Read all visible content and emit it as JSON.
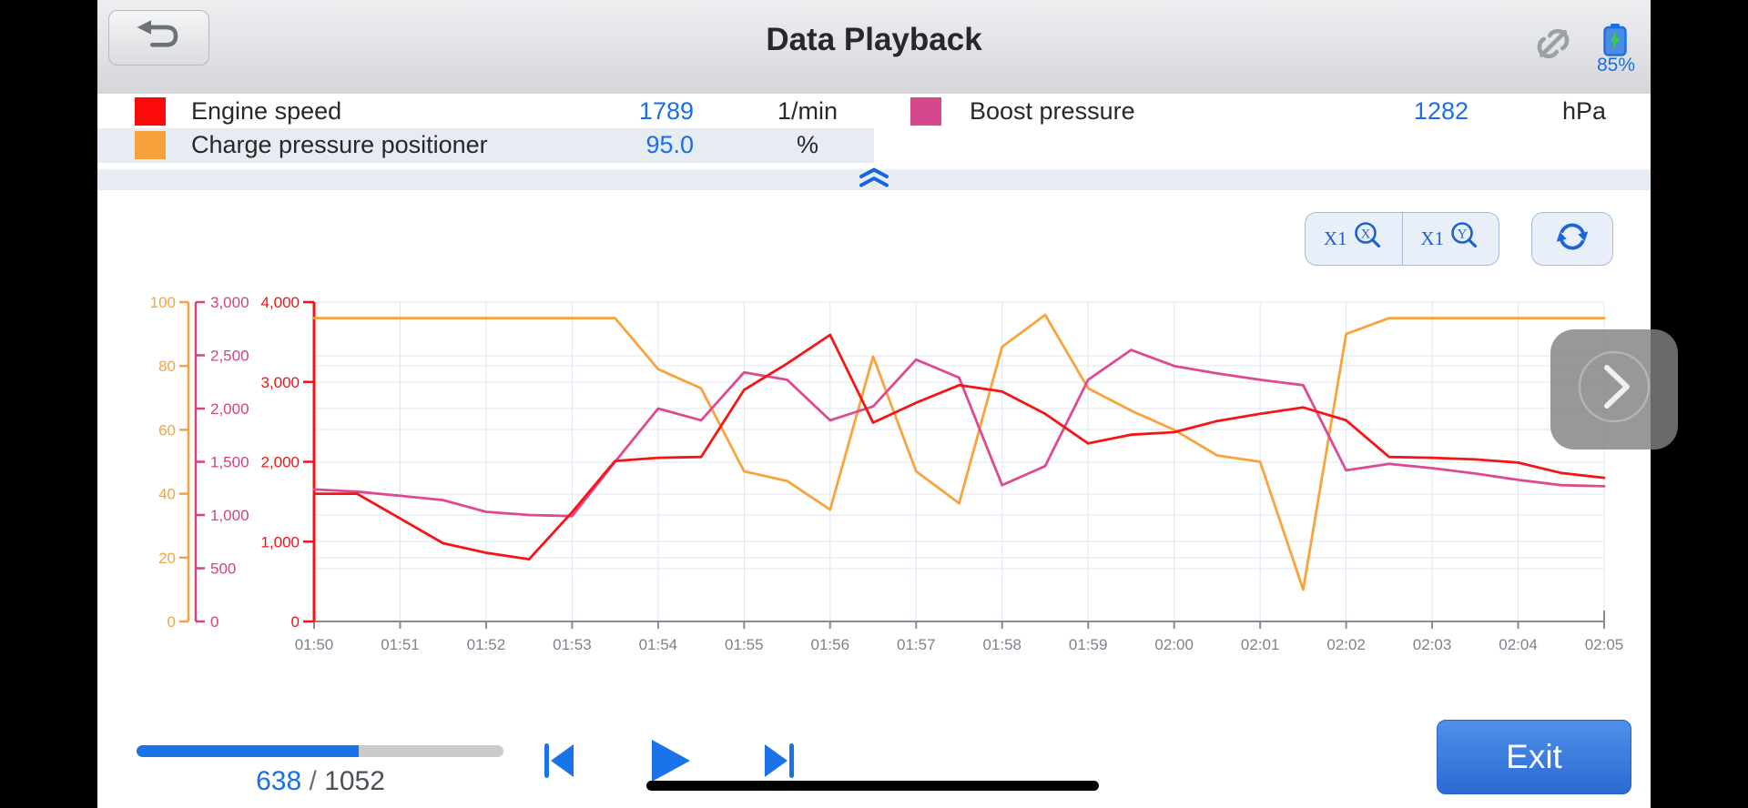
{
  "header": {
    "title": "Data Playback",
    "battery_percent": "85%"
  },
  "legend": {
    "items": [
      {
        "label": "Engine speed",
        "value": "1789",
        "unit": "1/min",
        "color": "#fb0a0a"
      },
      {
        "label": "Boost pressure",
        "value": "1282",
        "unit": "hPa",
        "color": "#d6488c"
      },
      {
        "label": "Charge pressure positioner",
        "value": "95.0",
        "unit": "%",
        "color": "#f9a23b"
      }
    ]
  },
  "controls": {
    "zoom_x_label": "X1",
    "zoom_x_letter": "X",
    "zoom_y_label": "X1",
    "zoom_y_letter": "Y"
  },
  "playback": {
    "current": "638",
    "separator": "/",
    "total": "1052",
    "progress_fraction": 0.606,
    "exit_label": "Exit"
  },
  "chart_data": {
    "type": "line",
    "x_tick_labels": [
      "01:50",
      "01:51",
      "01:52",
      "01:53",
      "01:54",
      "01:55",
      "01:56",
      "01:57",
      "01:58",
      "01:59",
      "02:00",
      "02:01",
      "02:02",
      "02:03",
      "02:04",
      "02:05"
    ],
    "x_range": [
      "01:50",
      "02:05"
    ],
    "grid": true,
    "y_axes": [
      {
        "series": "Charge pressure positioner",
        "color": "#f7a33c",
        "max": 100,
        "tick_labels": [
          "0",
          "20",
          "40",
          "60",
          "80",
          "100"
        ]
      },
      {
        "series": "Boost pressure",
        "color": "#d6417f",
        "max": 3000,
        "tick_labels": [
          "0",
          "500",
          "1,000",
          "1,500",
          "2,000",
          "2,500",
          "3,000"
        ]
      },
      {
        "series": "Engine speed",
        "color": "#f51111",
        "max": 4000,
        "tick_labels": [
          "0",
          "1,000",
          "2,000",
          "3,000",
          "4,000"
        ]
      }
    ],
    "series": [
      {
        "name": "Engine speed",
        "color": "#f81414",
        "axis_max": 4000,
        "values": [
          1600,
          1600,
          1290,
          980,
          860,
          780,
          1370,
          2010,
          2050,
          2060,
          2900,
          3230,
          3590,
          2490,
          2740,
          2960,
          2880,
          2600,
          2230,
          2340,
          2370,
          2510,
          2600,
          2680,
          2520,
          2060,
          2050,
          2030,
          1990,
          1860,
          1800
        ]
      },
      {
        "name": "Boost pressure",
        "color": "#dd4a92",
        "axis_max": 3000,
        "values": [
          1240,
          1220,
          1180,
          1140,
          1030,
          1000,
          990,
          1500,
          2000,
          1890,
          2340,
          2270,
          1890,
          2020,
          2460,
          2290,
          1280,
          1460,
          2270,
          2550,
          2400,
          2330,
          2270,
          2220,
          1420,
          1480,
          1440,
          1390,
          1330,
          1280,
          1270
        ]
      },
      {
        "name": "Charge pressure positioner",
        "color": "#f9a33d",
        "axis_max": 100,
        "values": [
          95,
          95,
          95,
          95,
          95,
          95,
          95,
          95,
          79,
          73,
          47,
          44,
          35,
          83,
          47,
          37,
          86,
          96,
          73,
          66,
          60,
          52,
          50,
          10,
          90,
          95,
          95,
          95,
          95,
          95,
          95
        ]
      }
    ]
  }
}
